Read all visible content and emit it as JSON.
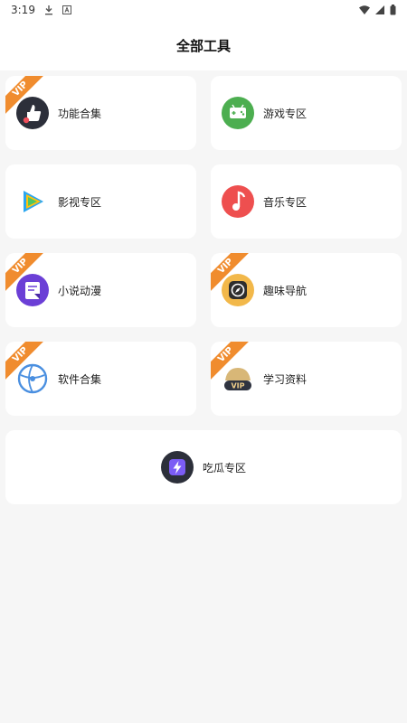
{
  "status_bar": {
    "time": "3:19"
  },
  "header": {
    "title": "全部工具"
  },
  "vip_label": "VIP",
  "tools": [
    {
      "label": "功能合集",
      "icon": "thumbs-up-icon",
      "vip": true
    },
    {
      "label": "游戏专区",
      "icon": "game-controller-icon",
      "vip": false
    },
    {
      "label": "影视专区",
      "icon": "video-play-icon",
      "vip": false
    },
    {
      "label": "音乐专区",
      "icon": "music-note-icon",
      "vip": false
    },
    {
      "label": "小说动漫",
      "icon": "book-icon",
      "vip": true
    },
    {
      "label": "趣味导航",
      "icon": "compass-icon",
      "vip": true
    },
    {
      "label": "软件合集",
      "icon": "software-globe-icon",
      "vip": true
    },
    {
      "label": "学习资料",
      "icon": "vip-hat-icon",
      "vip": true
    },
    {
      "label": "吃瓜专区",
      "icon": "lightning-icon",
      "vip": false
    }
  ],
  "colors": {
    "vip_badge": "#f08c2e",
    "background": "#f6f6f6"
  }
}
